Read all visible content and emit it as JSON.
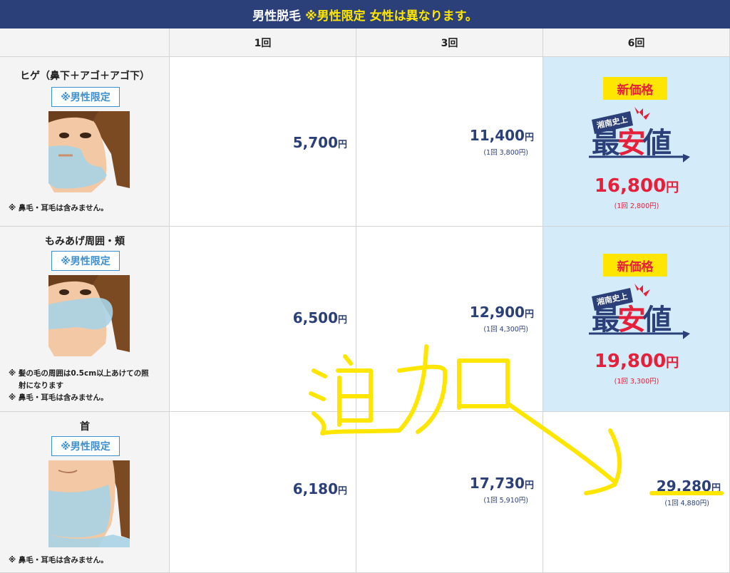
{
  "title": {
    "main": "男性脱毛",
    "highlight": "※男性限定 女性は異なります。"
  },
  "columns": [
    "1回",
    "3回",
    "6回"
  ],
  "badges": {
    "male_only": "※男性限定",
    "new_price": "新価格",
    "logo_small": "湘南史上",
    "logo_big": "最安値"
  },
  "rows": [
    {
      "area": "ヒゲ（鼻下＋アゴ＋アゴ下）",
      "notes": [
        "※ 鼻毛・耳毛は含みません。"
      ],
      "price1": "5,700",
      "price3": "11,400",
      "per3": "(1回 3,800円)",
      "price6": "16,800",
      "per6": "(1回 2,800円)"
    },
    {
      "area": "もみあげ周囲・頬",
      "notes": [
        "※ 髪の毛の周囲は0.5cm以上あけての照",
        "射になります",
        "※ 鼻毛・耳毛は含みません。"
      ],
      "price1": "6,500",
      "price3": "12,900",
      "per3": "(1回 4,300円)",
      "price6": "19,800",
      "per6": "(1回 3,300円)"
    },
    {
      "area": "首",
      "notes": [
        "※ 鼻毛・耳毛は含みません。"
      ],
      "price1": "6,180",
      "price3": "17,730",
      "per3": "(1回 5,910円)",
      "price6": "29,280",
      "per6": "(1回 4,880円)"
    }
  ],
  "yen": "円",
  "annotation": {
    "handwritten_text": "追加",
    "color": "#ffe600"
  },
  "colors": {
    "header_bg": "#2b3f78",
    "highlight": "#ffe600",
    "price_blue": "#2b3f78",
    "price_red": "#e5203a",
    "best_bg": "#d4ecfa",
    "badge_blue": "#3c8fd0"
  }
}
